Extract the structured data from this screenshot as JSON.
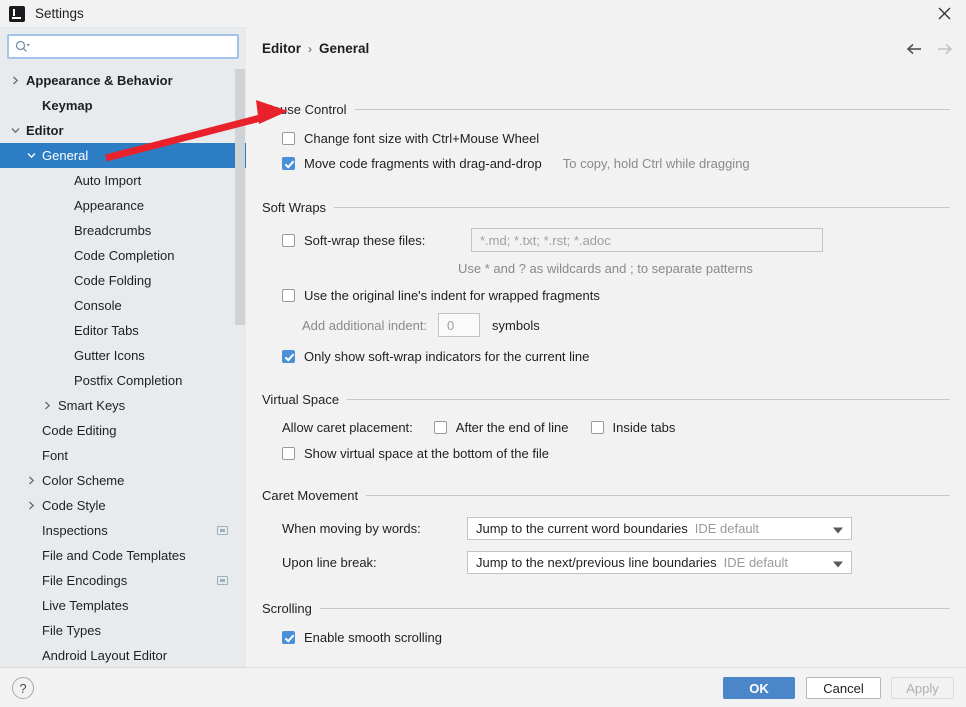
{
  "window": {
    "title": "Settings",
    "app_icon": "intellij-idea-logo",
    "close_icon": "close-icon"
  },
  "search": {
    "icon": "search-icon",
    "value": "",
    "placeholder": ""
  },
  "sidebar": {
    "items": [
      {
        "label": "Appearance & Behavior",
        "indent": 0,
        "twisty": "collapsed",
        "bold": true,
        "selected": false,
        "badge": false
      },
      {
        "label": "Keymap",
        "indent": 1,
        "twisty": "none",
        "bold": true,
        "selected": false,
        "badge": false
      },
      {
        "label": "Editor",
        "indent": 0,
        "twisty": "expanded",
        "bold": true,
        "selected": false,
        "badge": false
      },
      {
        "label": "General",
        "indent": 1,
        "twisty": "expanded",
        "bold": false,
        "selected": true,
        "badge": false
      },
      {
        "label": "Auto Import",
        "indent": 3,
        "twisty": "none",
        "bold": false,
        "selected": false,
        "badge": false
      },
      {
        "label": "Appearance",
        "indent": 3,
        "twisty": "none",
        "bold": false,
        "selected": false,
        "badge": false
      },
      {
        "label": "Breadcrumbs",
        "indent": 3,
        "twisty": "none",
        "bold": false,
        "selected": false,
        "badge": false
      },
      {
        "label": "Code Completion",
        "indent": 3,
        "twisty": "none",
        "bold": false,
        "selected": false,
        "badge": false
      },
      {
        "label": "Code Folding",
        "indent": 3,
        "twisty": "none",
        "bold": false,
        "selected": false,
        "badge": false
      },
      {
        "label": "Console",
        "indent": 3,
        "twisty": "none",
        "bold": false,
        "selected": false,
        "badge": false
      },
      {
        "label": "Editor Tabs",
        "indent": 3,
        "twisty": "none",
        "bold": false,
        "selected": false,
        "badge": false
      },
      {
        "label": "Gutter Icons",
        "indent": 3,
        "twisty": "none",
        "bold": false,
        "selected": false,
        "badge": false
      },
      {
        "label": "Postfix Completion",
        "indent": 3,
        "twisty": "none",
        "bold": false,
        "selected": false,
        "badge": false
      },
      {
        "label": "Smart Keys",
        "indent": 2,
        "twisty": "collapsed",
        "bold": false,
        "selected": false,
        "badge": false
      },
      {
        "label": "Code Editing",
        "indent": 1,
        "twisty": "none",
        "bold": false,
        "selected": false,
        "badge": false
      },
      {
        "label": "Font",
        "indent": 1,
        "twisty": "none",
        "bold": false,
        "selected": false,
        "badge": false
      },
      {
        "label": "Color Scheme",
        "indent": 1,
        "twisty": "collapsed",
        "bold": false,
        "selected": false,
        "badge": false
      },
      {
        "label": "Code Style",
        "indent": 1,
        "twisty": "collapsed",
        "bold": false,
        "selected": false,
        "badge": false
      },
      {
        "label": "Inspections",
        "indent": 1,
        "twisty": "none",
        "bold": false,
        "selected": false,
        "badge": true
      },
      {
        "label": "File and Code Templates",
        "indent": 1,
        "twisty": "none",
        "bold": false,
        "selected": false,
        "badge": false
      },
      {
        "label": "File Encodings",
        "indent": 1,
        "twisty": "none",
        "bold": false,
        "selected": false,
        "badge": true
      },
      {
        "label": "Live Templates",
        "indent": 1,
        "twisty": "none",
        "bold": false,
        "selected": false,
        "badge": false
      },
      {
        "label": "File Types",
        "indent": 1,
        "twisty": "none",
        "bold": false,
        "selected": false,
        "badge": false
      },
      {
        "label": "Android Layout Editor",
        "indent": 1,
        "twisty": "none",
        "bold": false,
        "selected": false,
        "badge": false
      }
    ]
  },
  "content": {
    "breadcrumb": {
      "root": "Editor",
      "separator": "›",
      "leaf": "General"
    },
    "nav": {
      "back_icon": "arrow-left-icon",
      "forward_icon": "arrow-right-icon"
    },
    "sections": {
      "mouse_control": {
        "title": "Mouse Control",
        "change_font_size": {
          "label": "Change font size with Ctrl+Mouse Wheel",
          "checked": false
        },
        "move_code_fragments": {
          "label": "Move code fragments with drag-and-drop",
          "checked": true
        },
        "move_code_hint": "To copy, hold Ctrl while dragging"
      },
      "soft_wraps": {
        "title": "Soft Wraps",
        "soft_wrap_files": {
          "label": "Soft-wrap these files:",
          "checked": false
        },
        "soft_wrap_field": {
          "value": "",
          "placeholder": "*.md; *.txt; *.rst; *.adoc"
        },
        "wildcard_hint": "Use * and ? as wildcards and ; to separate patterns",
        "original_indent": {
          "label": "Use the original line's indent for wrapped fragments",
          "checked": false
        },
        "additional_indent": {
          "label": "Add additional indent:",
          "value": "0",
          "unit": "symbols"
        },
        "only_show_indicators": {
          "label": "Only show soft-wrap indicators for the current line",
          "checked": true
        }
      },
      "virtual_space": {
        "title": "Virtual Space",
        "allow_caret_label": "Allow caret placement:",
        "after_end_of_line": {
          "label": "After the end of line",
          "checked": false
        },
        "inside_tabs": {
          "label": "Inside tabs",
          "checked": false
        },
        "show_virtual_space": {
          "label": "Show virtual space at the bottom of the file",
          "checked": false
        }
      },
      "caret_movement": {
        "title": "Caret Movement",
        "when_moving_by_words": {
          "label": "When moving by words:",
          "value": "Jump to the current word boundaries",
          "suffix": "IDE default",
          "arrow_icon": "chevron-down-icon"
        },
        "upon_line_break": {
          "label": "Upon line break:",
          "value": "Jump to the next/previous line boundaries",
          "suffix": "IDE default",
          "arrow_icon": "chevron-down-icon"
        }
      },
      "scrolling": {
        "title": "Scrolling",
        "enable_smooth_scrolling": {
          "label": "Enable smooth scrolling",
          "checked": true
        }
      }
    }
  },
  "footer": {
    "help_label": "?",
    "ok_label": "OK",
    "cancel_label": "Cancel",
    "apply_label": "Apply"
  },
  "annotation": {
    "type": "red-arrow",
    "color": "#e8212a",
    "points_to": "change-font-size-checkbox"
  },
  "colors": {
    "selection_blue": "#2d7dc4",
    "checkbox_blue": "#4a90d9",
    "ok_button_blue": "#4a86c8",
    "sidebar_bg": "#e7ebee",
    "content_bg": "#f2f2f2",
    "annotation_red": "#e8212a"
  }
}
